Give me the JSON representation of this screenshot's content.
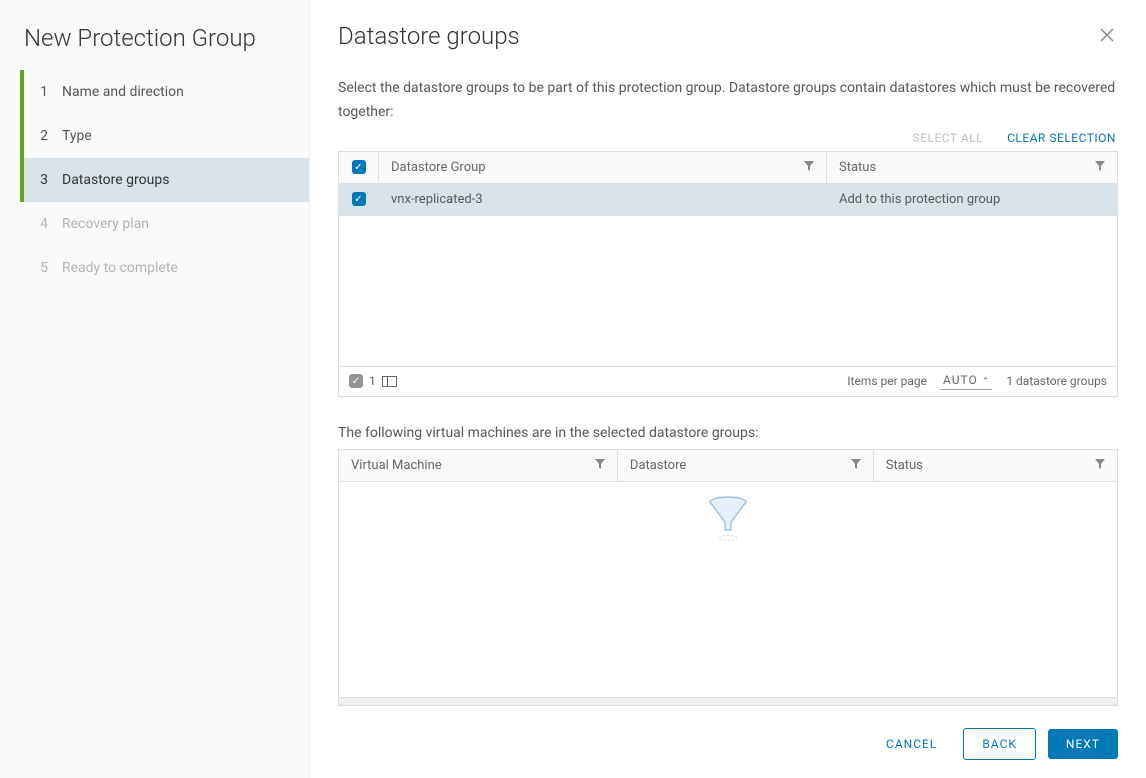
{
  "sidebar": {
    "title": "New Protection Group",
    "steps": [
      {
        "num": "1",
        "label": "Name and direction",
        "state": "done"
      },
      {
        "num": "2",
        "label": "Type",
        "state": "done"
      },
      {
        "num": "3",
        "label": "Datastore groups",
        "state": "active"
      },
      {
        "num": "4",
        "label": "Recovery plan",
        "state": "future"
      },
      {
        "num": "5",
        "label": "Ready to complete",
        "state": "future"
      }
    ]
  },
  "main": {
    "title": "Datastore groups",
    "description": "Select the datastore groups to be part of this protection group. Datastore groups contain datastores which must be recovered together:",
    "actions": {
      "select_all": "SELECT ALL",
      "clear_selection": "CLEAR SELECTION"
    },
    "datastore_table": {
      "columns": {
        "datastore_group": "Datastore Group",
        "status": "Status"
      },
      "rows": [
        {
          "name": "vnx-replicated-3",
          "status": "Add to this protection group"
        }
      ],
      "footer": {
        "selected_count": "1",
        "items_per_page_label": "Items per page",
        "items_per_page_value": "AUTO",
        "total_label": "1 datastore groups"
      }
    },
    "vm_description": "The following virtual machines are in the selected datastore groups:",
    "vm_table": {
      "columns": {
        "virtual_machine": "Virtual Machine",
        "datastore": "Datastore",
        "status": "Status"
      }
    }
  },
  "footer": {
    "cancel": "CANCEL",
    "back": "BACK",
    "next": "NEXT"
  }
}
